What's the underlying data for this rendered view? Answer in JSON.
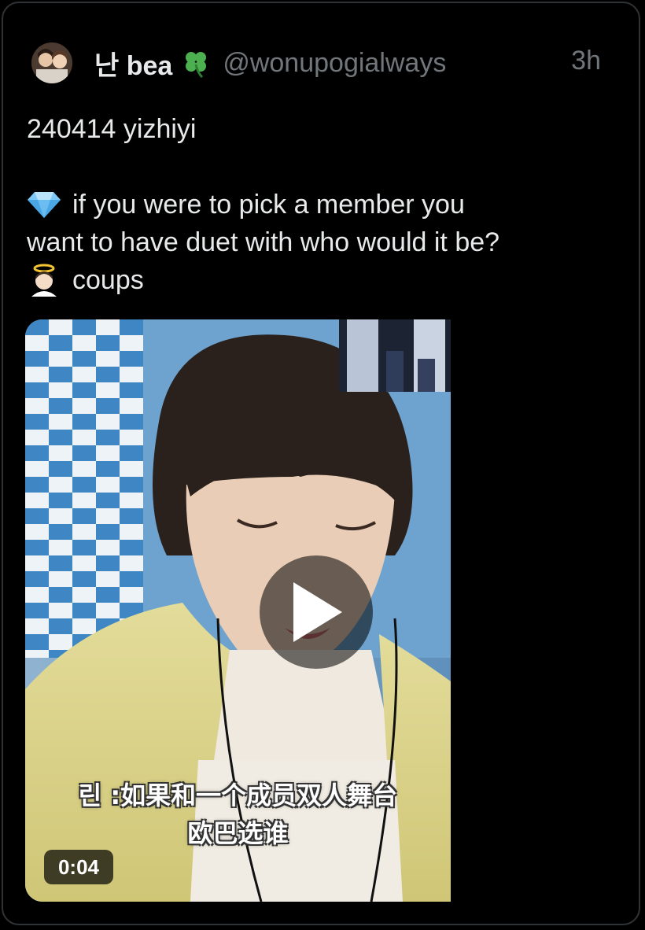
{
  "tweet": {
    "display_name": "난 bea",
    "handle": "@wonupogialways",
    "time": "3h",
    "icons": {
      "name_suffix": "four-leaf-clover-icon",
      "line1": "gem-icon",
      "line2": "angel-icon"
    },
    "lines": [
      "240414 yizhiyi",
      "",
      "if you were to pick a member you",
      "want to have duet with who would it be?",
      "coups"
    ]
  },
  "video": {
    "duration": "0:04",
    "caption_line1": "린 :如果和一个成员双人舞台",
    "caption_line2": "欧巴选谁"
  },
  "colors": {
    "background": "#000000",
    "text": "#e7e9ea",
    "muted": "#71767b",
    "border": "#2f3336"
  }
}
